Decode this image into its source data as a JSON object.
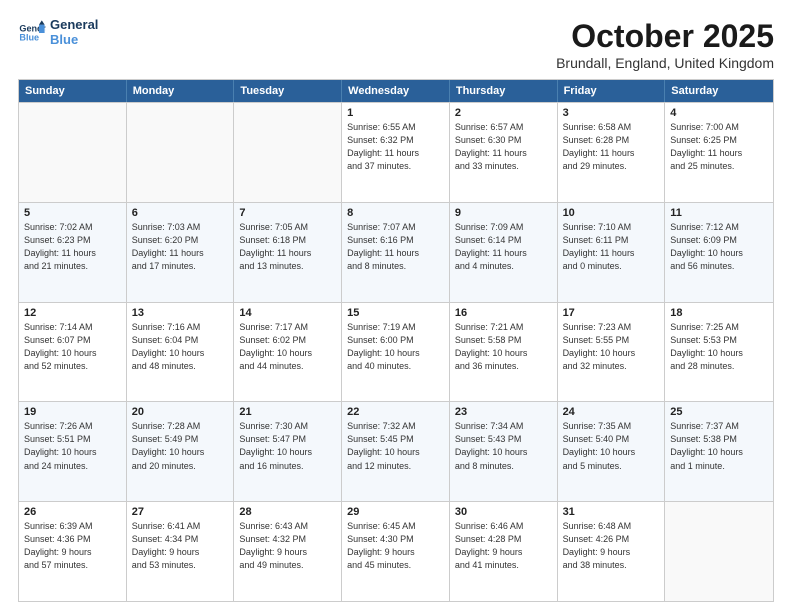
{
  "logo": {
    "line1": "General",
    "line2": "Blue"
  },
  "title": "October 2025",
  "location": "Brundall, England, United Kingdom",
  "weekdays": [
    "Sunday",
    "Monday",
    "Tuesday",
    "Wednesday",
    "Thursday",
    "Friday",
    "Saturday"
  ],
  "weeks": [
    [
      {
        "day": "",
        "info": ""
      },
      {
        "day": "",
        "info": ""
      },
      {
        "day": "",
        "info": ""
      },
      {
        "day": "1",
        "info": "Sunrise: 6:55 AM\nSunset: 6:32 PM\nDaylight: 11 hours\nand 37 minutes."
      },
      {
        "day": "2",
        "info": "Sunrise: 6:57 AM\nSunset: 6:30 PM\nDaylight: 11 hours\nand 33 minutes."
      },
      {
        "day": "3",
        "info": "Sunrise: 6:58 AM\nSunset: 6:28 PM\nDaylight: 11 hours\nand 29 minutes."
      },
      {
        "day": "4",
        "info": "Sunrise: 7:00 AM\nSunset: 6:25 PM\nDaylight: 11 hours\nand 25 minutes."
      }
    ],
    [
      {
        "day": "5",
        "info": "Sunrise: 7:02 AM\nSunset: 6:23 PM\nDaylight: 11 hours\nand 21 minutes."
      },
      {
        "day": "6",
        "info": "Sunrise: 7:03 AM\nSunset: 6:20 PM\nDaylight: 11 hours\nand 17 minutes."
      },
      {
        "day": "7",
        "info": "Sunrise: 7:05 AM\nSunset: 6:18 PM\nDaylight: 11 hours\nand 13 minutes."
      },
      {
        "day": "8",
        "info": "Sunrise: 7:07 AM\nSunset: 6:16 PM\nDaylight: 11 hours\nand 8 minutes."
      },
      {
        "day": "9",
        "info": "Sunrise: 7:09 AM\nSunset: 6:14 PM\nDaylight: 11 hours\nand 4 minutes."
      },
      {
        "day": "10",
        "info": "Sunrise: 7:10 AM\nSunset: 6:11 PM\nDaylight: 11 hours\nand 0 minutes."
      },
      {
        "day": "11",
        "info": "Sunrise: 7:12 AM\nSunset: 6:09 PM\nDaylight: 10 hours\nand 56 minutes."
      }
    ],
    [
      {
        "day": "12",
        "info": "Sunrise: 7:14 AM\nSunset: 6:07 PM\nDaylight: 10 hours\nand 52 minutes."
      },
      {
        "day": "13",
        "info": "Sunrise: 7:16 AM\nSunset: 6:04 PM\nDaylight: 10 hours\nand 48 minutes."
      },
      {
        "day": "14",
        "info": "Sunrise: 7:17 AM\nSunset: 6:02 PM\nDaylight: 10 hours\nand 44 minutes."
      },
      {
        "day": "15",
        "info": "Sunrise: 7:19 AM\nSunset: 6:00 PM\nDaylight: 10 hours\nand 40 minutes."
      },
      {
        "day": "16",
        "info": "Sunrise: 7:21 AM\nSunset: 5:58 PM\nDaylight: 10 hours\nand 36 minutes."
      },
      {
        "day": "17",
        "info": "Sunrise: 7:23 AM\nSunset: 5:55 PM\nDaylight: 10 hours\nand 32 minutes."
      },
      {
        "day": "18",
        "info": "Sunrise: 7:25 AM\nSunset: 5:53 PM\nDaylight: 10 hours\nand 28 minutes."
      }
    ],
    [
      {
        "day": "19",
        "info": "Sunrise: 7:26 AM\nSunset: 5:51 PM\nDaylight: 10 hours\nand 24 minutes."
      },
      {
        "day": "20",
        "info": "Sunrise: 7:28 AM\nSunset: 5:49 PM\nDaylight: 10 hours\nand 20 minutes."
      },
      {
        "day": "21",
        "info": "Sunrise: 7:30 AM\nSunset: 5:47 PM\nDaylight: 10 hours\nand 16 minutes."
      },
      {
        "day": "22",
        "info": "Sunrise: 7:32 AM\nSunset: 5:45 PM\nDaylight: 10 hours\nand 12 minutes."
      },
      {
        "day": "23",
        "info": "Sunrise: 7:34 AM\nSunset: 5:43 PM\nDaylight: 10 hours\nand 8 minutes."
      },
      {
        "day": "24",
        "info": "Sunrise: 7:35 AM\nSunset: 5:40 PM\nDaylight: 10 hours\nand 5 minutes."
      },
      {
        "day": "25",
        "info": "Sunrise: 7:37 AM\nSunset: 5:38 PM\nDaylight: 10 hours\nand 1 minute."
      }
    ],
    [
      {
        "day": "26",
        "info": "Sunrise: 6:39 AM\nSunset: 4:36 PM\nDaylight: 9 hours\nand 57 minutes."
      },
      {
        "day": "27",
        "info": "Sunrise: 6:41 AM\nSunset: 4:34 PM\nDaylight: 9 hours\nand 53 minutes."
      },
      {
        "day": "28",
        "info": "Sunrise: 6:43 AM\nSunset: 4:32 PM\nDaylight: 9 hours\nand 49 minutes."
      },
      {
        "day": "29",
        "info": "Sunrise: 6:45 AM\nSunset: 4:30 PM\nDaylight: 9 hours\nand 45 minutes."
      },
      {
        "day": "30",
        "info": "Sunrise: 6:46 AM\nSunset: 4:28 PM\nDaylight: 9 hours\nand 41 minutes."
      },
      {
        "day": "31",
        "info": "Sunrise: 6:48 AM\nSunset: 4:26 PM\nDaylight: 9 hours\nand 38 minutes."
      },
      {
        "day": "",
        "info": ""
      }
    ]
  ]
}
